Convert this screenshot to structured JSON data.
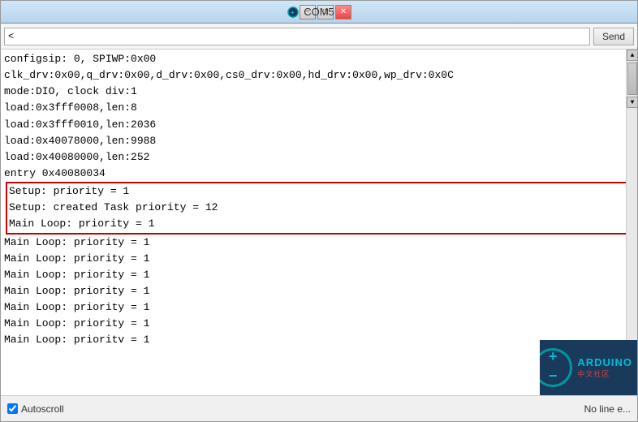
{
  "window": {
    "title": "COM5",
    "icon": "terminal-icon"
  },
  "title_buttons": {
    "minimize": "−",
    "maximize": "□",
    "close": "✕"
  },
  "toolbar": {
    "input_value": "<",
    "send_label": "Send"
  },
  "serial_output": {
    "lines": [
      {
        "text": "configsip: 0, SPIWP:0x00",
        "highlighted": false
      },
      {
        "text": "clk_drv:0x00,q_drv:0x00,d_drv:0x00,cs0_drv:0x00,hd_drv:0x00,wp_drv:0x0C",
        "highlighted": false
      },
      {
        "text": "mode:DIO, clock div:1",
        "highlighted": false
      },
      {
        "text": "load:0x3fff0008,len:8",
        "highlighted": false
      },
      {
        "text": "load:0x3fff0010,len:2036",
        "highlighted": false
      },
      {
        "text": "load:0x40078000,len:9988",
        "highlighted": false
      },
      {
        "text": "load:0x40080000,len:252",
        "highlighted": false
      },
      {
        "text": "entry 0x40080034",
        "highlighted": false
      },
      {
        "text": "Setup: priority = 1",
        "highlighted": true
      },
      {
        "text": "Setup: created Task priority = 12",
        "highlighted": true
      },
      {
        "text": "Main Loop: priority = 1",
        "highlighted": true
      },
      {
        "text": "Main Loop: priority = 1",
        "highlighted": false
      },
      {
        "text": "Main Loop: priority = 1",
        "highlighted": false
      },
      {
        "text": "Main Loop: priority = 1",
        "highlighted": false
      },
      {
        "text": "Main Loop: priority = 1",
        "highlighted": false
      },
      {
        "text": "Main Loop: priority = 1",
        "highlighted": false
      },
      {
        "text": "Main Loop: priority = 1",
        "highlighted": false
      },
      {
        "text": "Main Loop: prioritv = 1",
        "highlighted": false
      }
    ]
  },
  "status_bar": {
    "autoscroll_label": "Autoscroll",
    "autoscroll_checked": true,
    "no_line_end": "No line e..."
  },
  "arduino": {
    "label": "ARDUINO",
    "sublabel": "中文社区"
  }
}
